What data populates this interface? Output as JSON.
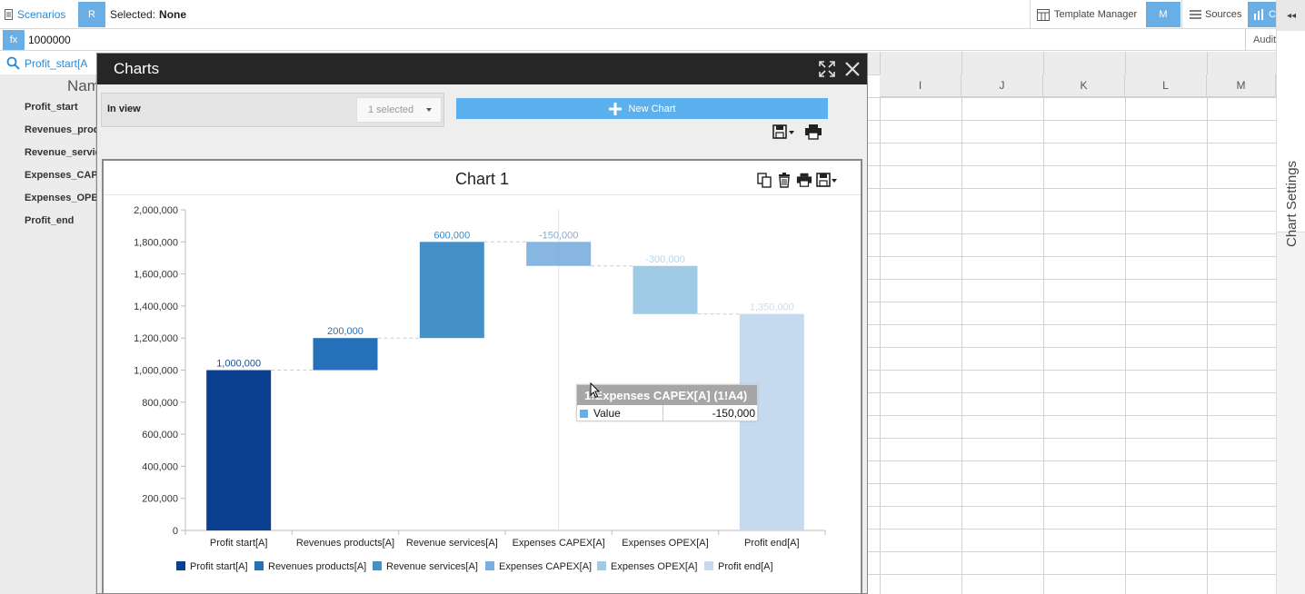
{
  "topbar": {
    "scenarios_label": "Scenarios",
    "r_button": "R",
    "selected_prefix": "Selected:",
    "selected_value": "None",
    "template_manager_label": "Template Manager",
    "m_button": "M",
    "sources_label": "Sources",
    "charts_button_label": "C"
  },
  "formula_bar": {
    "fx_label": "fx",
    "value": "1000000",
    "audit_label": "Audit"
  },
  "namebox": {
    "value": "Profit_start[A"
  },
  "sheet": {
    "name_header": "Nam",
    "rows": [
      {
        "name": "Profit_start"
      },
      {
        "name": "Revenues_products"
      },
      {
        "name": "Revenue_services"
      },
      {
        "name": "Expenses_CAPEX"
      },
      {
        "name": "Expenses_OPEX"
      },
      {
        "name": "Profit_end"
      }
    ],
    "columns": [
      "I",
      "J",
      "K",
      "L",
      "M"
    ]
  },
  "side_panel": {
    "toggle_label": "◂◂",
    "tab_label": "Chart Settings"
  },
  "charts_window": {
    "title": "Charts",
    "in_view_label": "In view",
    "select_value": "1 selected",
    "new_chart_label": "New Chart"
  },
  "chart_card": {
    "title": "Chart 1"
  },
  "tooltip": {
    "header": "1!Expenses CAPEX[A] (1!A4)",
    "row_label": "Value",
    "row_value": "-150,000"
  },
  "colors": {
    "accent": "#6aaee6",
    "new_chart": "#5bb0ee",
    "title_bar": "#262626"
  },
  "chart_data": {
    "type": "bar",
    "subtype": "waterfall",
    "title": "Chart 1",
    "categories": [
      "Profit start[A]",
      "Revenues products[A]",
      "Revenue services[A]",
      "Expenses CAPEX[A]",
      "Expenses OPEX[A]",
      "Profit end[A]"
    ],
    "values": [
      1000000,
      200000,
      600000,
      -150000,
      -300000,
      1350000
    ],
    "data_labels": [
      "1,000,000",
      "200,000",
      "600,000",
      "-150,000",
      "-300,000",
      "1,350,000"
    ],
    "base": [
      0,
      1000000,
      1200000,
      1650000,
      1350000,
      0
    ],
    "top": [
      1000000,
      1200000,
      1800000,
      1800000,
      1650000,
      1350000
    ],
    "colors": [
      "#0b3f8f",
      "#2570b8",
      "#4690c8",
      "#7aaede",
      "#9fcbe6",
      "#c6daef"
    ],
    "ylim": [
      0,
      2000000
    ],
    "yticks": [
      0,
      200000,
      400000,
      600000,
      800000,
      1000000,
      1200000,
      1400000,
      1600000,
      1800000,
      2000000
    ],
    "ytick_labels": [
      "0",
      "200,000",
      "400,000",
      "600,000",
      "800,000",
      "1,000,000",
      "1,200,000",
      "1,400,000",
      "1,600,000",
      "1,800,000",
      "2,000,000"
    ],
    "legend": [
      "Profit start[A]",
      "Revenues products[A]",
      "Revenue services[A]",
      "Expenses CAPEX[A]",
      "Expenses OPEX[A]",
      "Profit end[A]"
    ],
    "legend_position": "bottom",
    "grid": false
  }
}
